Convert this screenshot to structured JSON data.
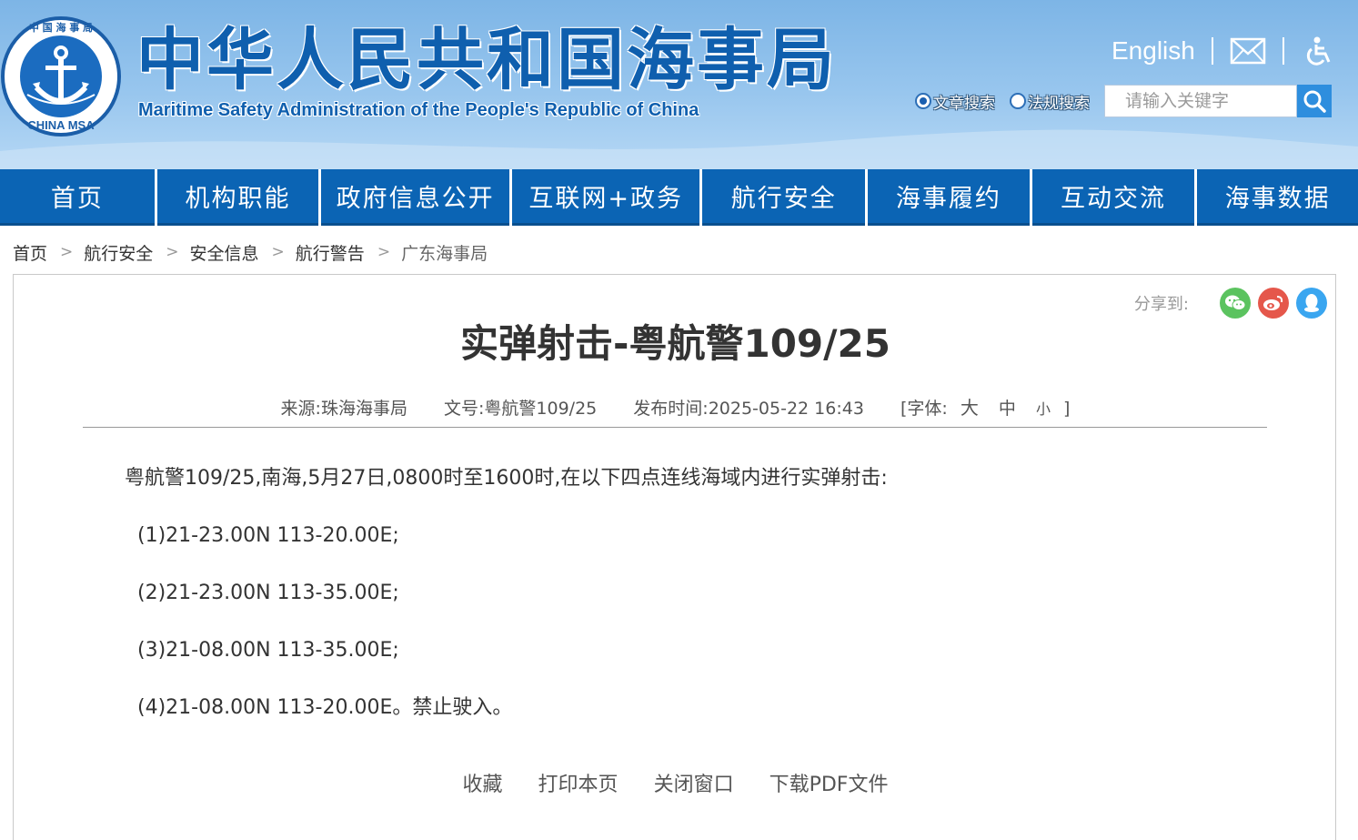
{
  "header": {
    "logo_text_top": "中 国 海 事 局",
    "logo_text_bottom": "CHINA MSA",
    "title_cn": "中华人民共和国海事局",
    "title_en": "Maritime Safety Administration of the People's Republic of China",
    "english_link": "English",
    "mail_icon": "mail-icon",
    "accessibility_icon": "wheelchair-icon"
  },
  "search": {
    "option_article": "文章搜索",
    "option_law": "法规搜索",
    "selected": "文章搜索",
    "placeholder": "请输入关键字",
    "value": ""
  },
  "nav": {
    "items": [
      "首页",
      "机构职能",
      "政府信息公开",
      "互联网+政务",
      "航行安全",
      "海事履约",
      "互动交流",
      "海事数据"
    ]
  },
  "breadcrumb": [
    "首页",
    "航行安全",
    "安全信息",
    "航行警告",
    "广东海事局"
  ],
  "share": {
    "label": "分享到:",
    "wechat_color": "#5bc35f",
    "weibo_color": "#e5574b",
    "qq_color": "#3aa6f0"
  },
  "article": {
    "title": "实弹射击-粤航警109/25",
    "source": "来源:珠海海事局",
    "doc_no": "文号:粤航警109/25",
    "published": "发布时间:2025-05-22 16:43",
    "font_label": "[字体:",
    "font_large": "大",
    "font_medium": "中",
    "font_small": "小",
    "font_close": "]",
    "body": [
      "粤航警109/25,南海,5月27日,0800时至1600时,在以下四点连线海域内进行实弹射击:",
      "(1)21-23.00N 113-20.00E;",
      "(2)21-23.00N 113-35.00E;",
      "(3)21-08.00N 113-35.00E;",
      "(4)21-08.00N 113-20.00E。禁止驶入。"
    ]
  },
  "actions": {
    "favorite": "收藏",
    "print": "打印本页",
    "close": "关闭窗口",
    "download_pdf": "下载PDF文件"
  },
  "colors": {
    "nav_bg": "#0b64b4",
    "title_blue": "#0f5fae"
  }
}
